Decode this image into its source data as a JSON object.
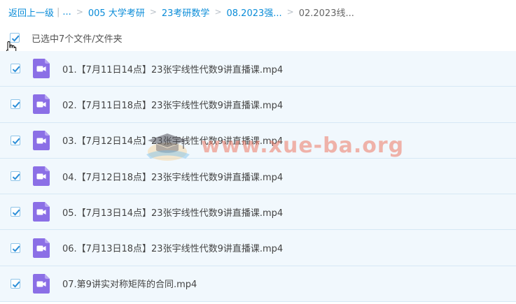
{
  "breadcrumb": {
    "back": "返回上一级",
    "sep": "|",
    "ellipsis": "...",
    "items": [
      "005 大学考研",
      "23考研数学",
      "08.2023强...",
      "02.2023线..."
    ]
  },
  "selection": {
    "label": "已选中7个文件/文件夹",
    "checked": true
  },
  "files": [
    {
      "name": "01.【7月11日14点】23张宇线性代数9讲直播课.mp4"
    },
    {
      "name": "02.【7月11日18点】23张宇线性代数9讲直播课.mp4"
    },
    {
      "name": "03.【7月12日14点】23张宇线性代数9讲直播课.mp4"
    },
    {
      "name": "04.【7月12日18点】23张宇线性代数9讲直播课.mp4"
    },
    {
      "name": "05.【7月13日14点】23张宇线性代数9讲直播课.mp4"
    },
    {
      "name": "06.【7月13日18点】23张宇线性代数9讲直播课.mp4"
    },
    {
      "name": "07.第9讲实对称矩阵的合同.mp4"
    }
  ],
  "watermark": {
    "text": "www.xue-ba.org"
  },
  "icons": {
    "checkbox": "check-icon",
    "file": "video-file-icon",
    "cursor": "hand-pointer-icon",
    "watermark": "graduation-cap-icon"
  },
  "colors": {
    "link": "#0a8cd8",
    "row_bg": "#f1f8fd",
    "check": "#2b8ed8",
    "file_icon": "#8b6fe6"
  }
}
